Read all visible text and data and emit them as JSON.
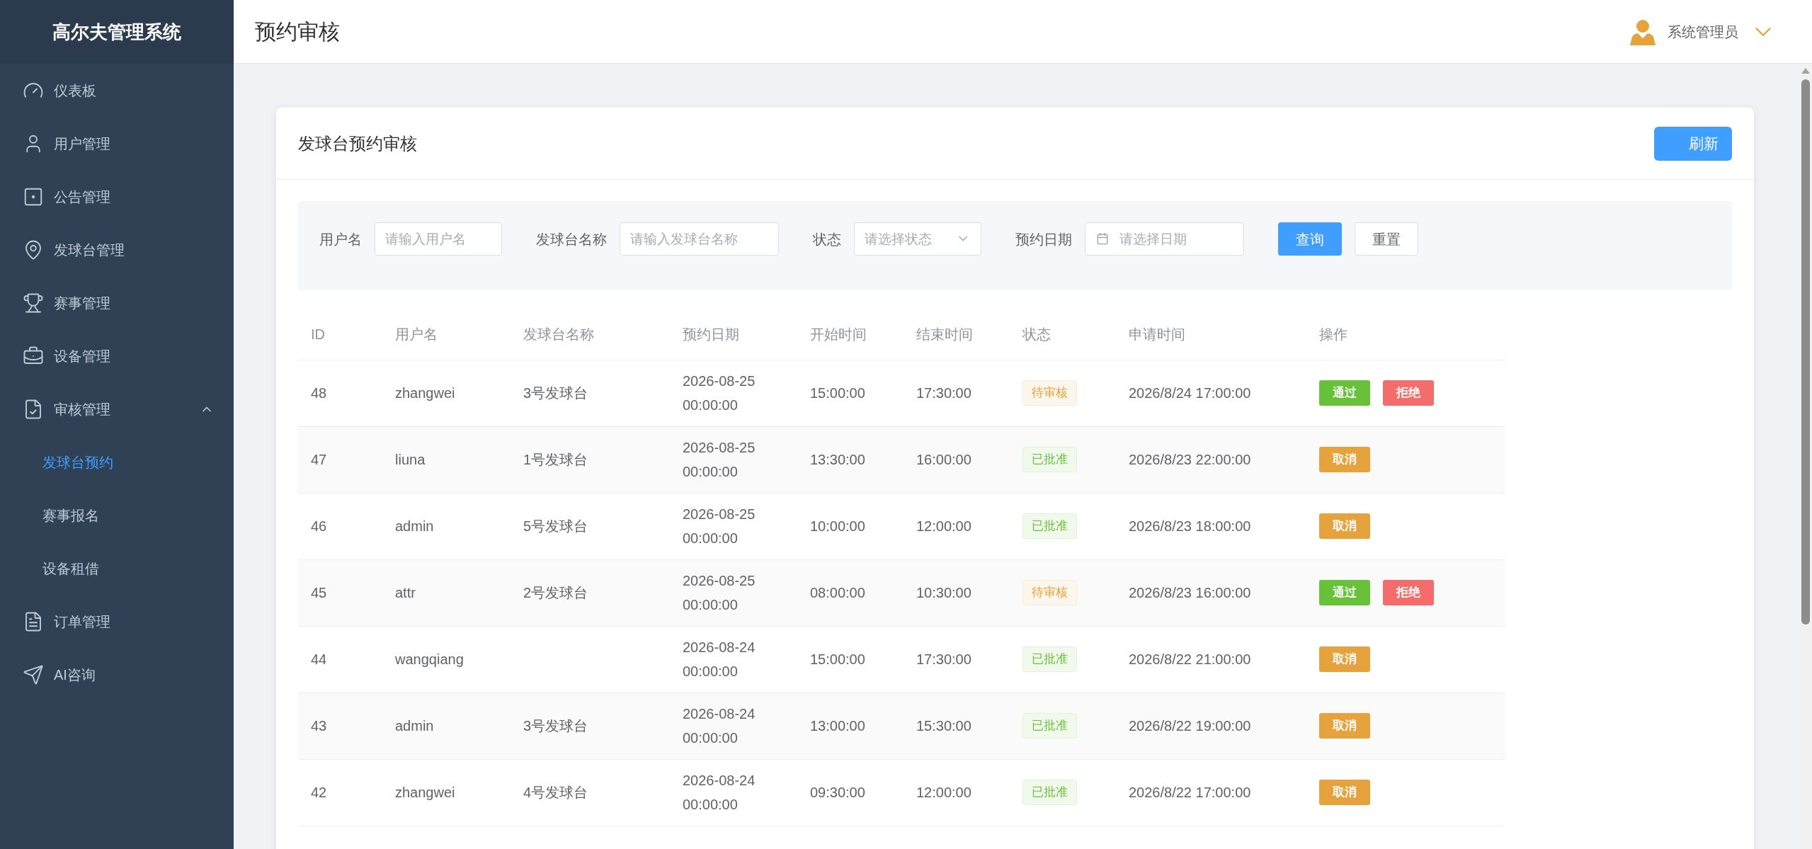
{
  "sidebar": {
    "title": "高尔夫管理系统",
    "items": [
      {
        "label": "仪表板",
        "selected": false
      },
      {
        "label": "用户管理",
        "selected": false
      },
      {
        "label": "公告管理",
        "selected": false
      },
      {
        "label": "发球台管理",
        "selected": false
      },
      {
        "label": "赛事管理",
        "selected": false
      },
      {
        "label": "设备管理",
        "selected": false
      },
      {
        "label": "审核管理",
        "selected": false,
        "expanded": true,
        "children": [
          {
            "label": "发球台预约",
            "selected": true
          },
          {
            "label": "赛事报名",
            "selected": false
          },
          {
            "label": "设备租借",
            "selected": false
          }
        ]
      },
      {
        "label": "订单管理",
        "selected": false
      },
      {
        "label": "AI咨询",
        "selected": false
      }
    ]
  },
  "header": {
    "title": "预约审核",
    "user": "系统管理员"
  },
  "card": {
    "title": "发球台预约审核",
    "refresh_button": "刷新"
  },
  "filters": {
    "fields": [
      {
        "label": "用户名",
        "placeholder": "请输入用户名",
        "kind": "text"
      },
      {
        "label": "发球台名称",
        "placeholder": "请输入发球台名称",
        "kind": "text"
      },
      {
        "label": "状态",
        "placeholder": "请选择状态",
        "kind": "select"
      },
      {
        "label": "预约日期",
        "placeholder": "请选择日期",
        "kind": "date"
      }
    ],
    "search_button": "查询",
    "reset_button": "重置"
  },
  "table": {
    "columns": [
      "ID",
      "用户名",
      "发球台名称",
      "预约日期",
      "开始时间",
      "结束时间",
      "状态",
      "申请时间",
      "操作"
    ],
    "rows": [
      {
        "id": "48",
        "user": "zhangwei",
        "tee": "3号发球台",
        "date": [
          "2026-08-25",
          "00:00:00"
        ],
        "start": "15:00:00",
        "end": "17:30:00",
        "status": {
          "label": "待审核",
          "kind": "pending"
        },
        "applied": "2026/8/24 17:00:00",
        "actions": [
          {
            "label": "通过",
            "kind": "approve"
          },
          {
            "label": "拒绝",
            "kind": "reject"
          }
        ]
      },
      {
        "id": "47",
        "user": "liuna",
        "tee": "1号发球台",
        "date": [
          "2026-08-25",
          "00:00:00"
        ],
        "start": "13:30:00",
        "end": "16:00:00",
        "status": {
          "label": "已批准",
          "kind": "approved"
        },
        "applied": "2026/8/23 22:00:00",
        "actions": [
          {
            "label": "取消",
            "kind": "cancel"
          }
        ]
      },
      {
        "id": "46",
        "user": "admin",
        "tee": "5号发球台",
        "date": [
          "2026-08-25",
          "00:00:00"
        ],
        "start": "10:00:00",
        "end": "12:00:00",
        "status": {
          "label": "已批准",
          "kind": "approved"
        },
        "applied": "2026/8/23 18:00:00",
        "actions": [
          {
            "label": "取消",
            "kind": "cancel"
          }
        ]
      },
      {
        "id": "45",
        "user": "attr",
        "tee": "2号发球台",
        "date": [
          "2026-08-25",
          "00:00:00"
        ],
        "start": "08:00:00",
        "end": "10:30:00",
        "status": {
          "label": "待审核",
          "kind": "pending"
        },
        "applied": "2026/8/23 16:00:00",
        "actions": [
          {
            "label": "通过",
            "kind": "approve"
          },
          {
            "label": "拒绝",
            "kind": "reject"
          }
        ]
      },
      {
        "id": "44",
        "user": "wangqiang",
        "date": [
          "2026-08-24",
          "00:00:00"
        ],
        "start": "15:00:00",
        "end": "17:30:00",
        "status": {
          "label": "已批准",
          "kind": "approved"
        },
        "applied": "2026/8/22 21:00:00",
        "actions": [
          {
            "label": "取消",
            "kind": "cancel"
          }
        ]
      },
      {
        "id": "43",
        "user": "admin",
        "tee": "3号发球台",
        "date": [
          "2026-08-24",
          "00:00:00"
        ],
        "start": "13:00:00",
        "end": "15:30:00",
        "status": {
          "label": "已批准",
          "kind": "approved"
        },
        "applied": "2026/8/22 19:00:00",
        "actions": [
          {
            "label": "取消",
            "kind": "cancel"
          }
        ]
      },
      {
        "id": "42",
        "user": "zhangwei",
        "tee": "4号发球台",
        "date": [
          "2026-08-24",
          "00:00:00"
        ],
        "start": "09:30:00",
        "end": "12:00:00",
        "status": {
          "label": "已批准",
          "kind": "approved"
        },
        "applied": "2026/8/22 17:00:00",
        "actions": [
          {
            "label": "取消",
            "kind": "cancel"
          }
        ]
      }
    ]
  }
}
